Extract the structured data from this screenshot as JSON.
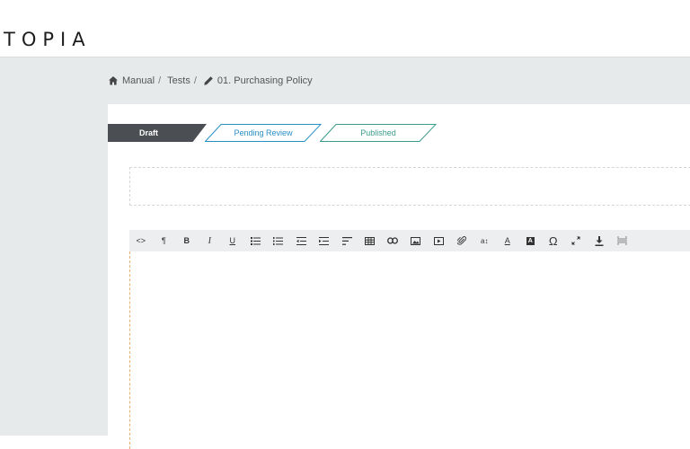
{
  "app": {
    "logo": "TOPIA"
  },
  "breadcrumb": {
    "items": [
      {
        "label": "Manual",
        "icon": "home-icon"
      },
      {
        "label": "Tests"
      },
      {
        "label": "01. Purchasing Policy",
        "icon": "pencil-icon"
      }
    ],
    "separator": "/"
  },
  "status_steps": [
    {
      "label": "Draft",
      "state": "active",
      "color": "#4b4f54"
    },
    {
      "label": "Pending Review",
      "state": "inactive",
      "color": "#2a8fc7"
    },
    {
      "label": "Published",
      "state": "inactive",
      "color": "#3b9c8c"
    }
  ],
  "toolbar": {
    "buttons": [
      {
        "name": "code-view-icon",
        "glyph": "<>"
      },
      {
        "name": "paragraph-format-icon",
        "glyph": "¶"
      },
      {
        "name": "bold-icon",
        "glyph": "B"
      },
      {
        "name": "italic-icon",
        "glyph": "I"
      },
      {
        "name": "underline-icon",
        "glyph": "U"
      },
      {
        "name": "unordered-list-icon",
        "glyph": ""
      },
      {
        "name": "ordered-list-icon",
        "glyph": ""
      },
      {
        "name": "outdent-icon",
        "glyph": ""
      },
      {
        "name": "indent-icon",
        "glyph": ""
      },
      {
        "name": "align-left-icon",
        "glyph": ""
      },
      {
        "name": "table-icon",
        "glyph": ""
      },
      {
        "name": "link-icon",
        "glyph": ""
      },
      {
        "name": "image-icon",
        "glyph": ""
      },
      {
        "name": "video-icon",
        "glyph": ""
      },
      {
        "name": "attachment-icon",
        "glyph": ""
      },
      {
        "name": "font-size-icon",
        "glyph": "a↕"
      },
      {
        "name": "text-color-icon",
        "glyph": "A"
      },
      {
        "name": "background-color-icon",
        "glyph": "A"
      },
      {
        "name": "special-characters-icon",
        "glyph": "Ω"
      },
      {
        "name": "fullscreen-icon",
        "glyph": "⤢"
      },
      {
        "name": "download-icon",
        "glyph": "⤓"
      },
      {
        "name": "page-break-icon",
        "glyph": ""
      }
    ]
  },
  "colors": {
    "shell_bg": "#e7eaeb",
    "accent_blue": "#2a8fc7",
    "accent_teal": "#3b9c8c"
  }
}
